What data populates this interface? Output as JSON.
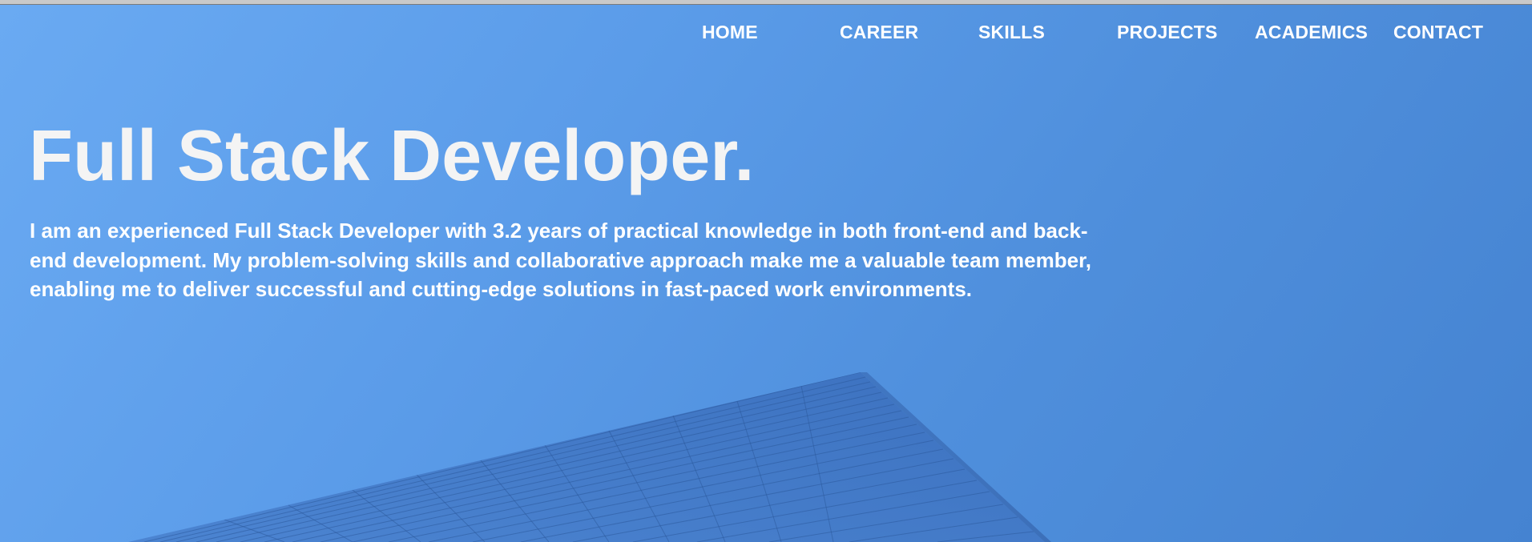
{
  "nav": {
    "items": [
      {
        "label": "HOME"
      },
      {
        "label": "CAREER"
      },
      {
        "label": "SKILLS"
      },
      {
        "label": "PROJECTS"
      },
      {
        "label": "ACADEMICS"
      },
      {
        "label": "CONTACT"
      }
    ]
  },
  "hero": {
    "title": "Full Stack Developer.",
    "description": "I am an experienced Full Stack Developer with 3.2 years of practical knowledge in both front-end and back-end development. My problem-solving skills and collaborative approach make me a valuable team member, enabling me to deliver successful and cutting-edge solutions in fast-paced work environments."
  },
  "colors": {
    "background": "#5b9ce9",
    "text": "#ffffff",
    "building": "#3f74c2"
  }
}
